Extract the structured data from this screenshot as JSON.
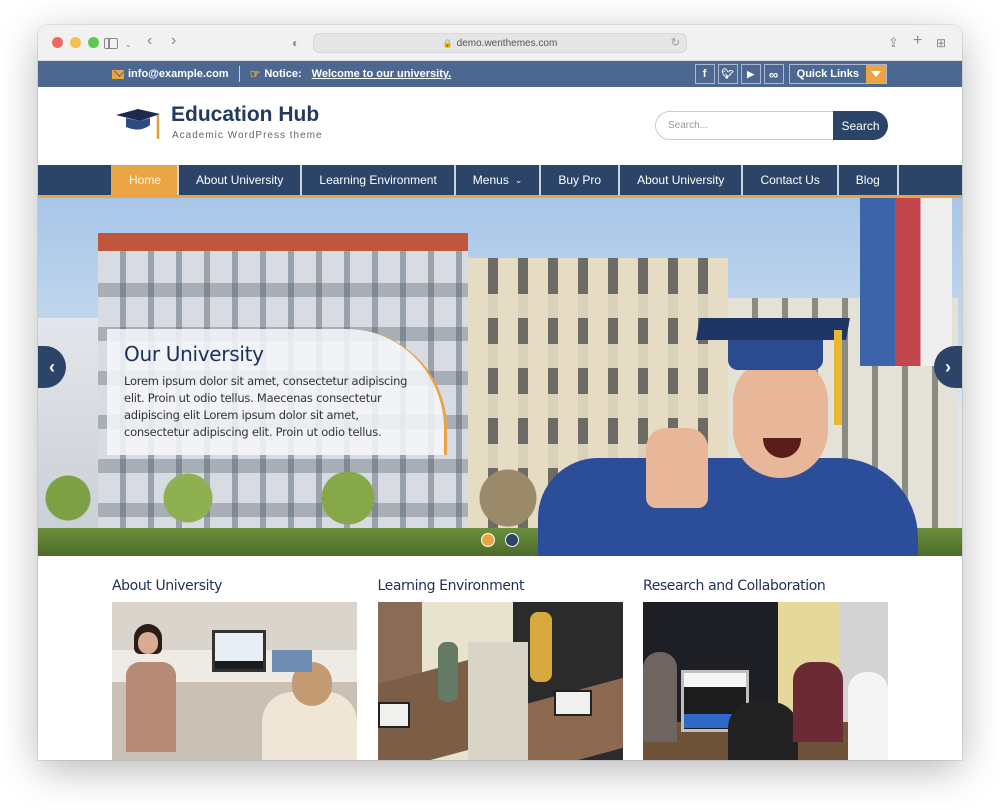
{
  "browser": {
    "url": "demo.wenthemes.com"
  },
  "topbar": {
    "email": "info@example.com",
    "notice_label": "Notice:",
    "notice_text": "Welcome to our university.",
    "social": [
      {
        "name": "facebook-icon",
        "glyph": "f"
      },
      {
        "name": "twitter-icon",
        "glyph": "🐦"
      },
      {
        "name": "youtube-icon",
        "glyph": "▶"
      },
      {
        "name": "link-icon",
        "glyph": "∞"
      }
    ],
    "quick_links_label": "Quick Links"
  },
  "header": {
    "site_title": "Education Hub",
    "tagline": "Academic WordPress theme",
    "search_placeholder": "Search...",
    "search_button": "Search"
  },
  "nav": {
    "items": [
      {
        "label": "Home",
        "active": true
      },
      {
        "label": "About University"
      },
      {
        "label": "Learning Environment"
      },
      {
        "label": "Menus",
        "has_dropdown": true
      },
      {
        "label": "Buy Pro"
      },
      {
        "label": "About University"
      },
      {
        "label": "Contact Us"
      },
      {
        "label": "Blog"
      }
    ]
  },
  "slider": {
    "title": "Our University",
    "text": "Lorem ipsum dolor sit amet, consectetur adipiscing elit. Proin ut odio tellus. Maecenas consectetur adipiscing elit Lorem ipsum dolor sit amet, consectetur adipiscing elit. Proin ut odio tellus.",
    "slide_count": 2,
    "active_slide": 1
  },
  "features": [
    {
      "title": "About University"
    },
    {
      "title": "Learning Environment"
    },
    {
      "title": "Research and Collaboration"
    }
  ],
  "colors": {
    "primary": "#2c4468",
    "topbar": "#4c6891",
    "accent": "#eba443"
  }
}
